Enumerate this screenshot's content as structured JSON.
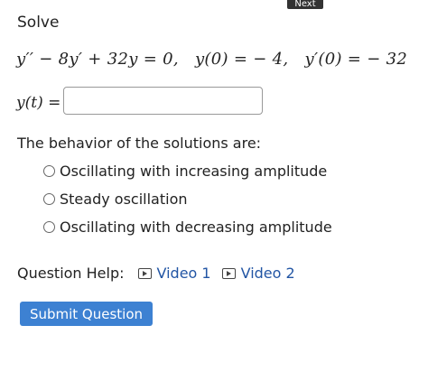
{
  "top_button": {
    "label": "Next"
  },
  "question": {
    "instruction": "Solve",
    "equation": {
      "lhs": "y′′ − 8y′ + 32y = 0,",
      "ic1": "y(0) = − 4,",
      "ic2": "y′(0) = − 32"
    },
    "answer_label": "y(t)",
    "answer_equals": " =",
    "answer_value": ""
  },
  "behavior": {
    "prompt": "The behavior of the solutions are:",
    "options": [
      {
        "label": "Oscillating with increasing amplitude",
        "selected": false
      },
      {
        "label": "Steady oscillation",
        "selected": false
      },
      {
        "label": "Oscillating with decreasing amplitude",
        "selected": false
      }
    ]
  },
  "help": {
    "label": "Question Help:",
    "links": [
      {
        "label": "Video 1",
        "icon": "play-icon"
      },
      {
        "label": "Video 2",
        "icon": "play-icon"
      }
    ]
  },
  "submit": {
    "label": "Submit Question"
  }
}
